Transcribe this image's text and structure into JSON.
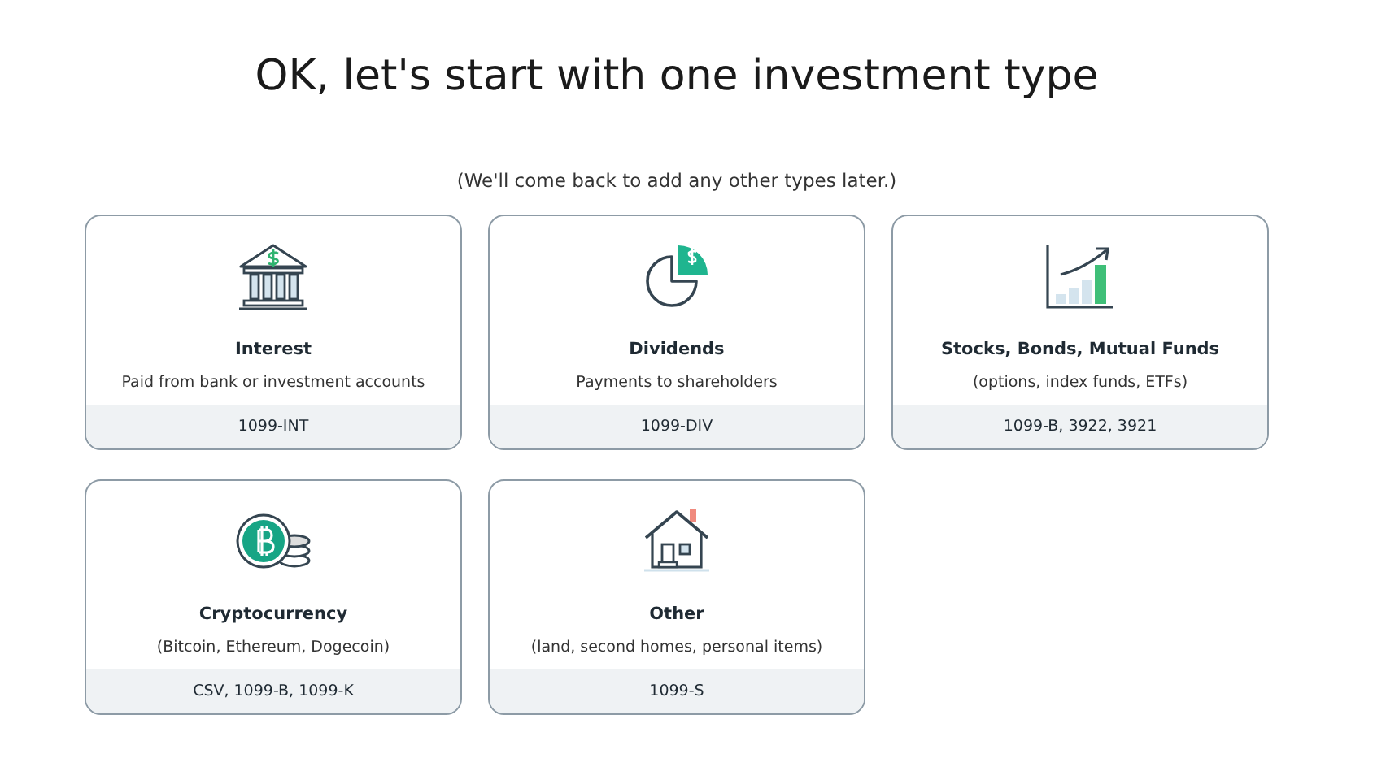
{
  "heading": "OK, let's start with one investment type",
  "subheading": "(We'll come back to add any other types later.)",
  "cards": [
    {
      "kind": "bank",
      "title": "Interest",
      "description": "Paid from bank or investment accounts",
      "forms": "1099-INT"
    },
    {
      "kind": "pie",
      "title": "Dividends",
      "description": "Payments to shareholders",
      "forms": "1099-DIV"
    },
    {
      "kind": "chart",
      "title": "Stocks, Bonds, Mutual Funds",
      "description": "(options, index funds, ETFs)",
      "forms": "1099-B, 3922, 3921"
    },
    {
      "kind": "coin",
      "title": "Cryptocurrency",
      "description": "(Bitcoin, Ethereum, Dogecoin)",
      "forms": "CSV, 1099-B, 1099-K"
    },
    {
      "kind": "house",
      "title": "Other",
      "description": "(land, second homes, personal items)",
      "forms": "1099-S"
    }
  ]
}
